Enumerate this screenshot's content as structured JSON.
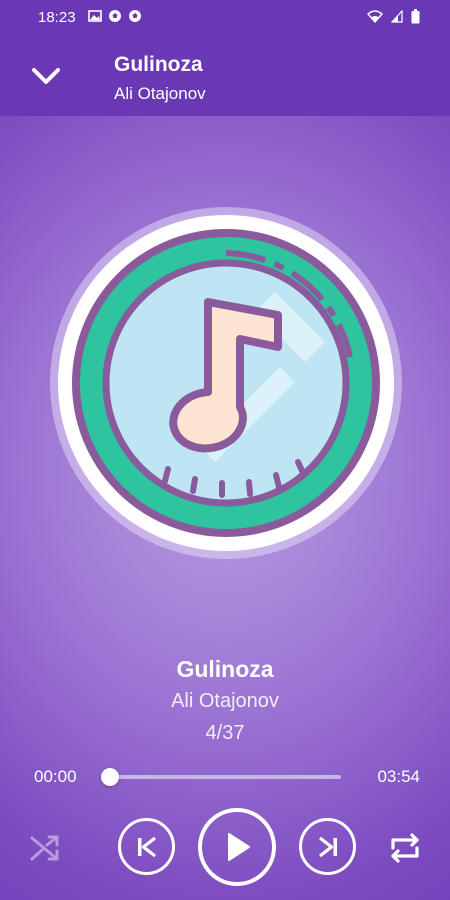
{
  "status_bar": {
    "time": "18:23",
    "left_icons": [
      "image-icon",
      "soccer-ball-icon",
      "soccer-ball-icon"
    ],
    "right_icons": [
      "wifi-icon",
      "signal-icon",
      "battery-icon"
    ]
  },
  "toolbar": {
    "collapse_icon": "chevron-down-icon",
    "title": "Gulinoza",
    "artist": "Ali Otajonov"
  },
  "now_playing": {
    "art_icon": "music-note-disc-icon",
    "title": "Gulinoza",
    "artist": "Ali Otajonov",
    "track_position": "4/37"
  },
  "progress": {
    "current_time": "00:00",
    "total_time": "03:54",
    "fraction": 0.0
  },
  "controls": [
    {
      "name": "shuffle-button",
      "icon": "shuffle-icon",
      "enabled": false
    },
    {
      "name": "previous-button",
      "icon": "skip-previous-icon"
    },
    {
      "name": "play-button",
      "icon": "play-icon"
    },
    {
      "name": "next-button",
      "icon": "skip-next-icon"
    },
    {
      "name": "repeat-button",
      "icon": "repeat-icon"
    }
  ],
  "colors": {
    "bar": "#6a37b5",
    "background_center": "#b99ee0",
    "background_edge": "#6a36b2",
    "disc_teal": "#2ec4a0",
    "disc_outline": "#8a5a9c",
    "note_fill": "#fbe4d0"
  }
}
